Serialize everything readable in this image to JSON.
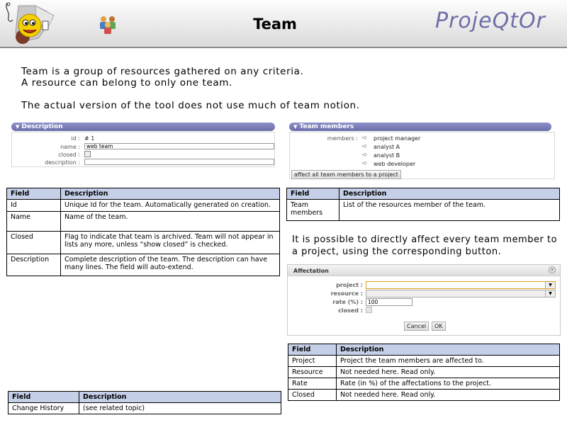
{
  "header": {
    "title": "Team",
    "brand": "ProjeQtOr",
    "logo_icon": "smiley-mascot-logo",
    "team_icon": "team-people-icon"
  },
  "intro": {
    "line1": "Team is a group of resources gathered on any criteria.",
    "line2": "A resource can belong to only one team.",
    "line3": "The actual version of the tool does not use much of team notion."
  },
  "description_panel": {
    "title": "Description",
    "id_label": "id :",
    "id_value": "# 1",
    "name_label": "name :",
    "name_value": "web team",
    "closed_label": "closed :",
    "description_label": "description :"
  },
  "members_panel": {
    "title": "Team members",
    "members_label": "members :",
    "members": [
      "project manager",
      "analyst A",
      "analyst B",
      "web developer"
    ],
    "affect_button": "affect all team members to a project"
  },
  "desc_table": {
    "headers": [
      "Field",
      "Description"
    ],
    "rows": [
      [
        "Id",
        "Unique Id for the team. Automatically generated on creation."
      ],
      [
        "Name",
        "Name of the team."
      ],
      [
        "Closed",
        "Flag to indicate that team is archived. Team will not appear in lists any more, unless “show closed” is checked."
      ],
      [
        "Description",
        "Complete description of the team. The description can have many lines. The field will auto-extend."
      ]
    ]
  },
  "members_table": {
    "headers": [
      "Field",
      "Description"
    ],
    "rows": [
      [
        "Team members",
        "List of the resources member of the team."
      ]
    ]
  },
  "affect_paragraph": "It is possible to directly affect every team member to a project, using the corresponding button.",
  "dialog": {
    "title": "Affectation",
    "project_label": "project :",
    "resource_label": "resource :",
    "rate_label": "rate (%) :",
    "rate_value": "100",
    "closed_label": "closed :",
    "cancel_button": "Cancel",
    "ok_button": "OK"
  },
  "affect_table": {
    "headers": [
      "Field",
      "Description"
    ],
    "rows": [
      [
        "Project",
        "Project the team members are affected to."
      ],
      [
        "Resource",
        "Not needed here. Read only."
      ],
      [
        "Rate",
        "Rate (in %) of the affectations to the project."
      ],
      [
        "Closed",
        "Not needed here. Read only."
      ]
    ]
  },
  "history_table": {
    "headers": [
      "Field",
      "Description"
    ],
    "rows": [
      [
        "Change History",
        "(see related topic)"
      ]
    ]
  }
}
